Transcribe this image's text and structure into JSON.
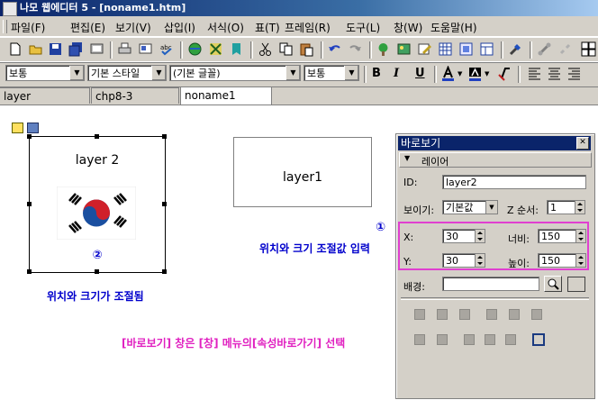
{
  "window": {
    "title": "나모 웹에디터 5 - [noname1.htm]"
  },
  "menu": [
    "파일(F)",
    "편집(E)",
    "보기(V)",
    "삽입(I)",
    "서식(O)",
    "표(T)",
    "프레임(R)",
    "도구(L)",
    "창(W)",
    "도움말(H)"
  ],
  "format_bar": {
    "paragraph": "보통",
    "style": "기본 스타일",
    "font": "(기본 글꼴)",
    "size": "보통",
    "bold": "B",
    "italic": "I",
    "underline": "U"
  },
  "tabs": [
    "layer",
    "chp8-3",
    "noname1"
  ],
  "canvas": {
    "layer2_text": "layer 2",
    "layer1_text": "layer1",
    "marker1": "①",
    "marker2": "②",
    "anno1": "위치와 크기 조절값 입력",
    "anno2": "위치와 크기가 조절됨",
    "anno3": "[바로보기] 창은 [창] 메뉴의[속성바로가기] 선택"
  },
  "panel": {
    "title": "바로보기",
    "section": "레이어",
    "id_label": "ID:",
    "id_value": "layer2",
    "visibility_label": "보이기:",
    "visibility_value": "기본값",
    "z_label": "Z 순서:",
    "z_value": "1",
    "x_label": "X:",
    "x_value": "30",
    "width_label": "너비:",
    "width_value": "150",
    "y_label": "Y:",
    "y_value": "30",
    "height_label": "높이:",
    "height_value": "150",
    "bg_label": "배경:",
    "bg_value": ""
  },
  "colors": {
    "annotation_blue": "#0000cc",
    "annotation_magenta": "#e020c0",
    "highlight_box": "#e040d0",
    "titlebar": "#0a246a"
  }
}
